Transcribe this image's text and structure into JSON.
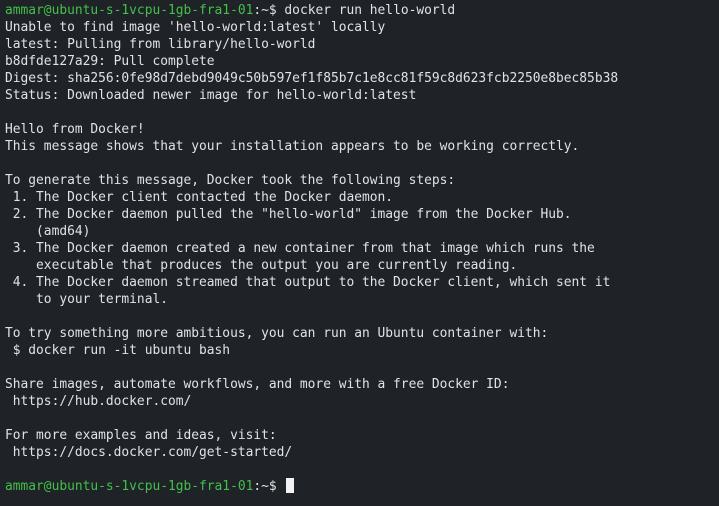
{
  "prompt1": {
    "user_host": "ammar@ubuntu-s-1vcpu-1gb-fra1-01",
    "separator": ":",
    "path_symbol": "~$",
    "command": " docker run hello-world"
  },
  "pull_lines": [
    "Unable to find image 'hello-world:latest' locally",
    "latest: Pulling from library/hello-world",
    "b8dfde127a29: Pull complete",
    "Digest: sha256:0fe98d7debd9049c50b597ef1f85b7c1e8cc81f59c8d623fcb2250e8bec85b38",
    "Status: Downloaded newer image for hello-world:latest"
  ],
  "message": {
    "hello": "Hello from Docker!",
    "works": "This message shows that your installation appears to be working correctly.",
    "steps_intro": "To generate this message, Docker took the following steps:",
    "steps": [
      " 1. The Docker client contacted the Docker daemon.",
      " 2. The Docker daemon pulled the \"hello-world\" image from the Docker Hub.",
      "    (amd64)",
      " 3. The Docker daemon created a new container from that image which runs the",
      "    executable that produces the output you are currently reading.",
      " 4. The Docker daemon streamed that output to the Docker client, which sent it",
      "    to your terminal."
    ],
    "ubuntu_intro": "To try something more ambitious, you can run an Ubuntu container with:",
    "ubuntu_cmd": " $ docker run -it ubuntu bash",
    "share_intro": "Share images, automate workflows, and more with a free Docker ID:",
    "share_url": " https://hub.docker.com/",
    "more_intro": "For more examples and ideas, visit:",
    "more_url": " https://docs.docker.com/get-started/"
  },
  "prompt2": {
    "user_host": "ammar@ubuntu-s-1vcpu-1gb-fra1-01",
    "separator": ":",
    "path_symbol": "~$",
    "command": " "
  }
}
